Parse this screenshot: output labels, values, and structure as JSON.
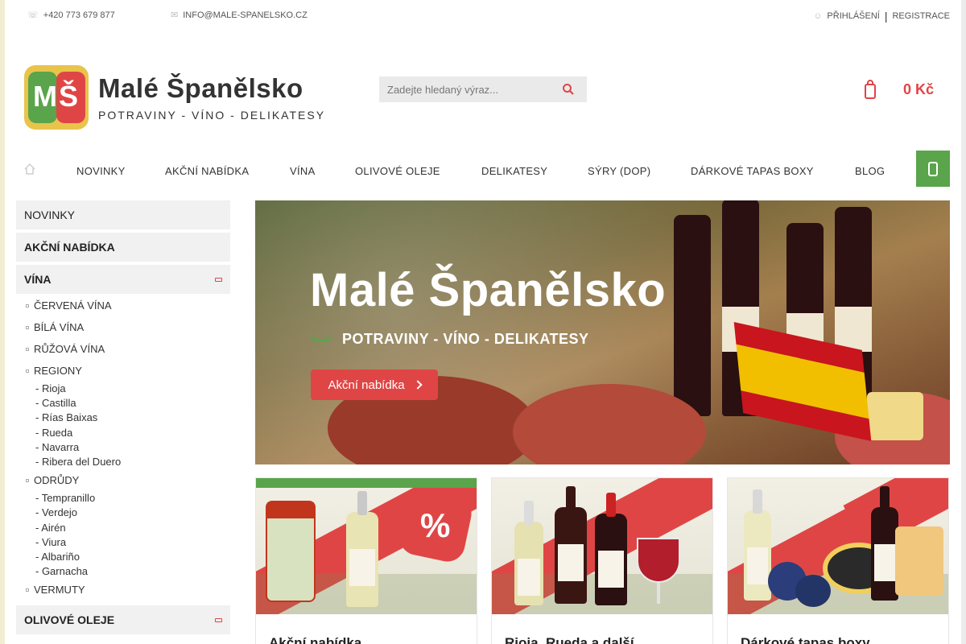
{
  "topbar": {
    "phone": "+420 773 679 877",
    "email": "INFO@MALE-SPANELSKO.CZ",
    "login": "PŘIHLÁŠENÍ",
    "separator": "|",
    "register": "REGISTRACE"
  },
  "logo": {
    "badge": "MŠ",
    "title": "Malé Španělsko",
    "subtitle": "POTRAVINY - VÍNO - DELIKATESY"
  },
  "search": {
    "placeholder": "Zadejte hledaný výraz..."
  },
  "cart": {
    "amount": "0 Kč"
  },
  "nav": {
    "items": [
      "NOVINKY",
      "AKČNÍ NABÍDKA",
      "VÍNA",
      "OLIVOVÉ OLEJE",
      "DELIKATESY",
      "SÝRY (DOP)",
      "DÁRKOVÉ TAPAS BOXY",
      "BLOG"
    ]
  },
  "sidebar": {
    "categories": {
      "novinky": "NOVINKY",
      "akcni": "AKČNÍ NABÍDKA",
      "vina": "VÍNA",
      "olivove": "OLIVOVÉ OLEJE"
    },
    "vina_sub": {
      "cervena": "ČERVENÁ VÍNA",
      "bila": "BÍLÁ VÍNA",
      "ruzova": "RŮŽOVÁ VÍNA",
      "regiony": "REGIONY",
      "regiony_items": [
        "- Rioja",
        "- Castilla",
        "- Rías Baixas",
        "- Rueda",
        "- Navarra",
        "- Ribera del Duero"
      ],
      "odrudy": "ODRŮDY",
      "odrudy_items": [
        "- Tempranillo",
        "- Verdejo",
        "- Airén",
        "- Viura",
        "- Albariño",
        "- Garnacha"
      ],
      "vermuty": "VERMUTY"
    }
  },
  "banner": {
    "title": "Malé Španělsko",
    "subtitle": "POTRAVINY - VÍNO - DELIKATESY",
    "button": "Akční nabídka"
  },
  "tiles": {
    "t1": {
      "caption": "Akční nabídka",
      "badge": "%"
    },
    "t2": {
      "caption": "Rioja, Rueda a další"
    },
    "t3": {
      "caption": "Dárkové tapas boxy"
    }
  },
  "colors": {
    "accent_green": "#5aa44b",
    "accent_red": "#e04545",
    "logo_yellow": "#e8c44b"
  },
  "icons": {
    "phone": "phone-icon",
    "mail": "mail-icon",
    "user": "user-icon",
    "search": "search-icon",
    "cart": "cart-icon",
    "home": "home-icon",
    "menu": "menu-icon"
  }
}
